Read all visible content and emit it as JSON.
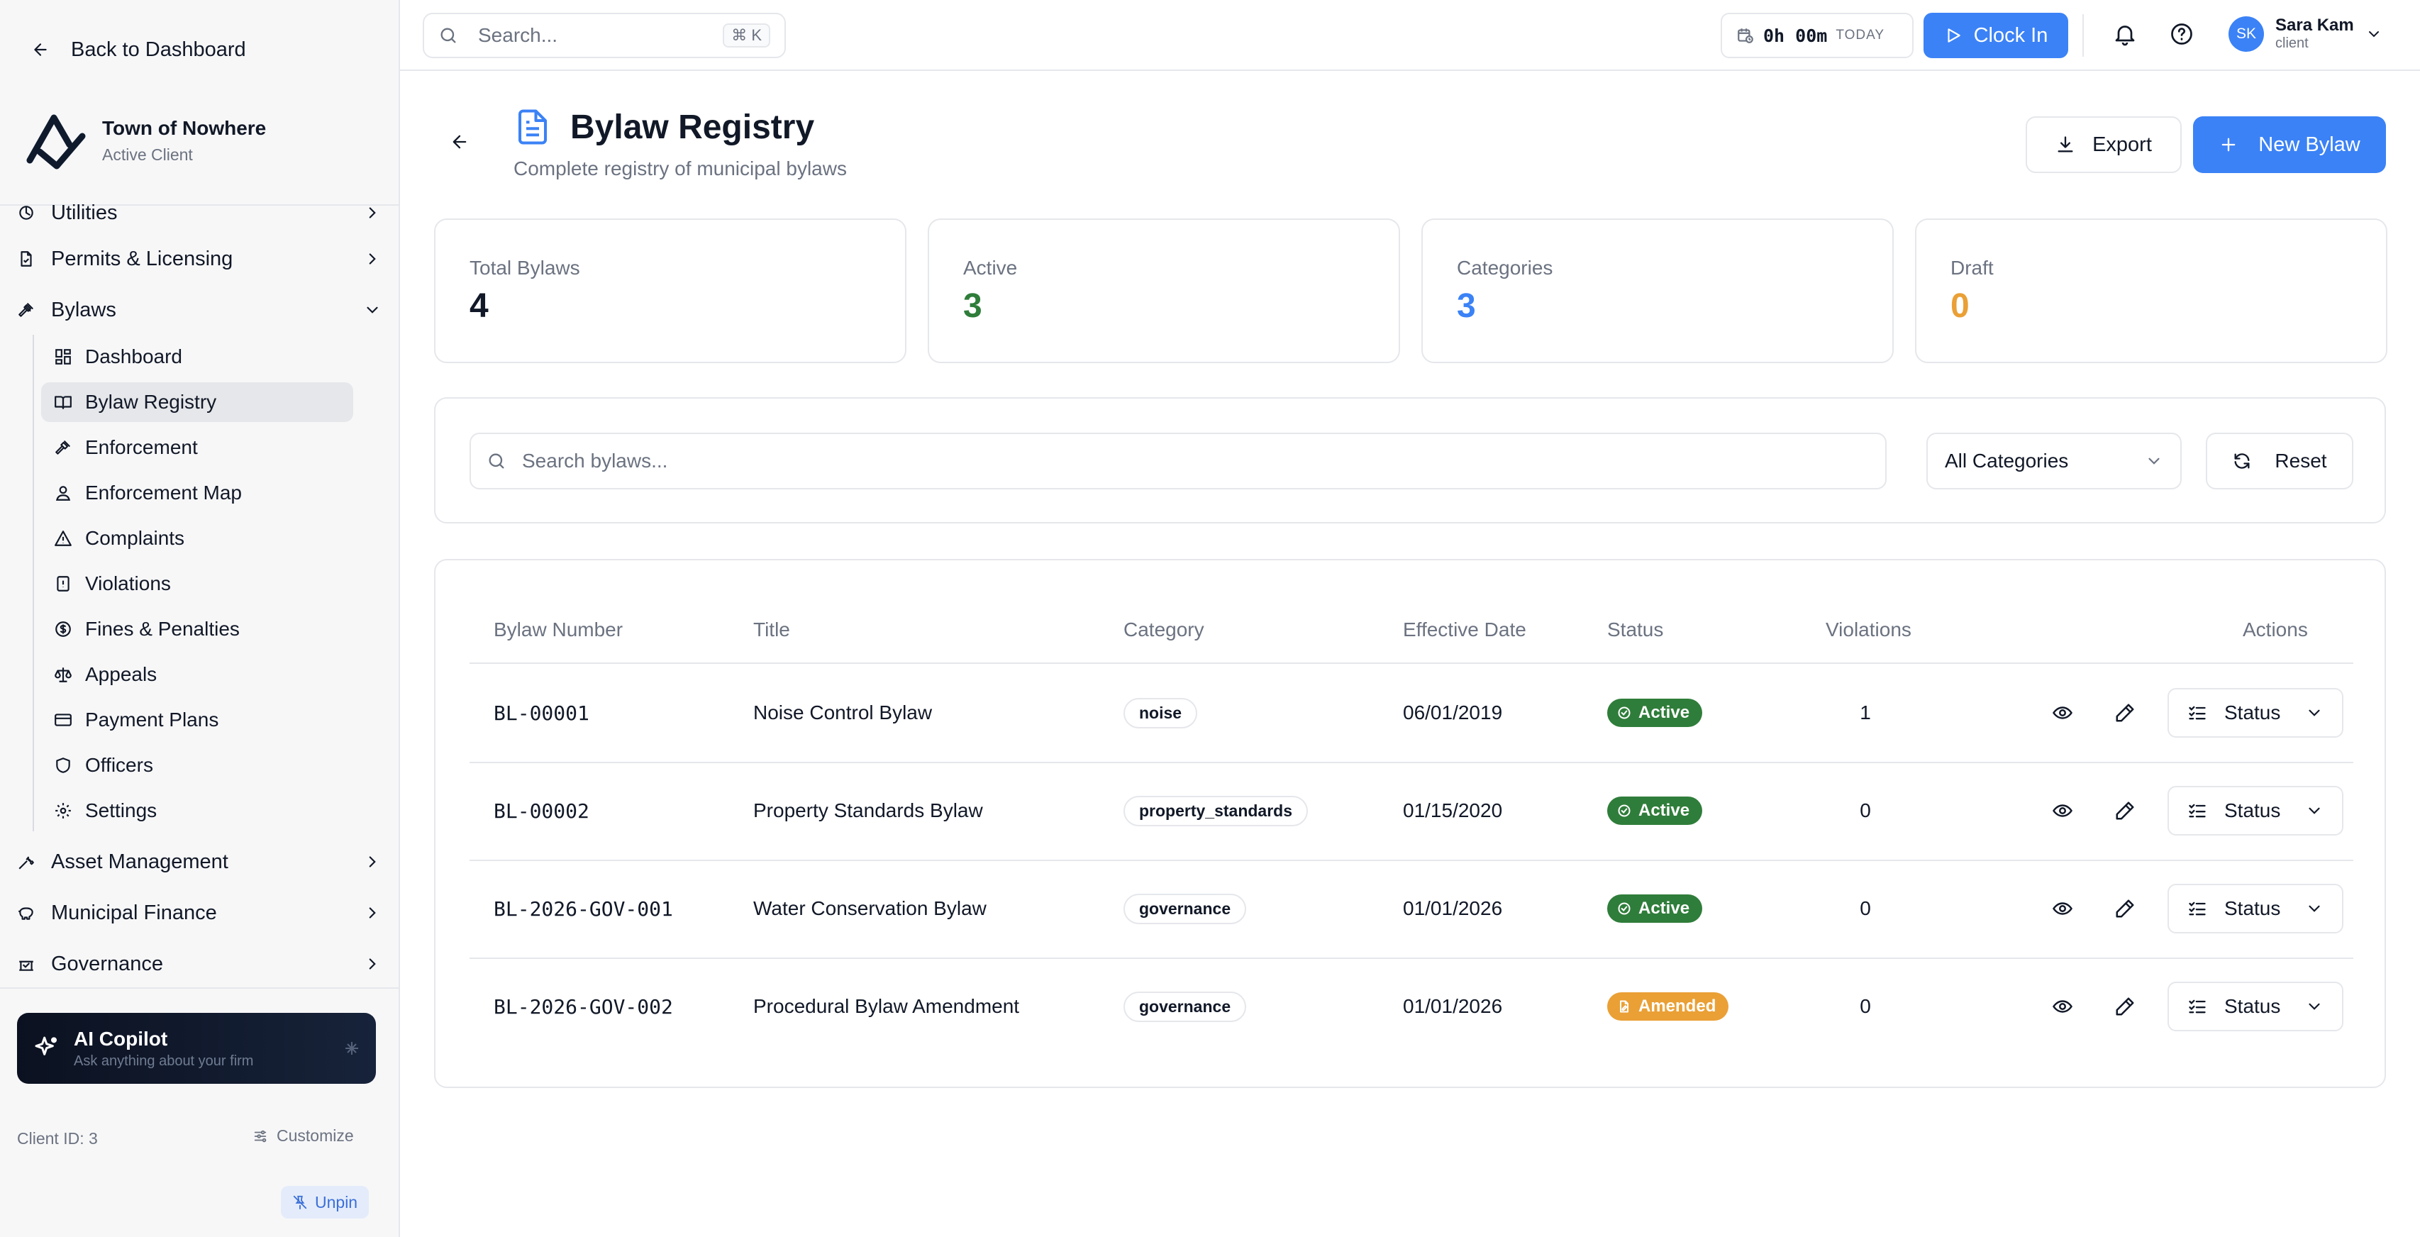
{
  "sidebar": {
    "back_label": "Back to Dashboard",
    "brand_name": "Town of Nowhere",
    "brand_sub": "Active Client",
    "nav": {
      "utilities": "Utilities",
      "permits": "Permits & Licensing",
      "bylaws": "Bylaws",
      "asset": "Asset Management",
      "finance": "Municipal Finance",
      "governance": "Governance"
    },
    "sub": {
      "dashboard": "Dashboard",
      "registry": "Bylaw Registry",
      "enforcement": "Enforcement",
      "map": "Enforcement Map",
      "complaints": "Complaints",
      "violations": "Violations",
      "fines": "Fines & Penalties",
      "appeals": "Appeals",
      "payment": "Payment Plans",
      "officers": "Officers",
      "settings": "Settings"
    },
    "copilot": {
      "title": "AI Copilot",
      "subtitle": "Ask anything about your firm"
    },
    "client_id": "Client ID: 3",
    "customize": "Customize",
    "unpin": "Unpin"
  },
  "topbar": {
    "search_placeholder": "Search...",
    "shortcut": "⌘ K",
    "timer": "0h 00m",
    "timer_label": "TODAY",
    "clock_in": "Clock In",
    "user_initials": "SK",
    "user_name": "Sara Kam",
    "user_role": "client"
  },
  "page": {
    "title": "Bylaw Registry",
    "subtitle": "Complete registry of municipal bylaws",
    "export_label": "Export",
    "new_label": "New Bylaw"
  },
  "stats": [
    {
      "label": "Total Bylaws",
      "value": "4",
      "color": "#111827"
    },
    {
      "label": "Active",
      "value": "3",
      "color": "#2f7d3a"
    },
    {
      "label": "Categories",
      "value": "3",
      "color": "#3b82f6"
    },
    {
      "label": "Draft",
      "value": "0",
      "color": "#eaa035"
    }
  ],
  "filters": {
    "search_placeholder": "Search bylaws...",
    "category": "All Categories",
    "reset": "Reset"
  },
  "table": {
    "headers": {
      "number": "Bylaw Number",
      "title": "Title",
      "category": "Category",
      "date": "Effective Date",
      "status": "Status",
      "violations": "Violations",
      "actions": "Actions"
    },
    "status_action": "Status",
    "rows": [
      {
        "number": "BL-00001",
        "title": "Noise Control Bylaw",
        "category": "noise",
        "date": "06/01/2019",
        "status": "Active",
        "violations": "1"
      },
      {
        "number": "BL-00002",
        "title": "Property Standards Bylaw",
        "category": "property_standards",
        "date": "01/15/2020",
        "status": "Active",
        "violations": "0"
      },
      {
        "number": "BL-2026-GOV-001",
        "title": "Water Conservation Bylaw",
        "category": "governance",
        "date": "01/01/2026",
        "status": "Active",
        "violations": "0"
      },
      {
        "number": "BL-2026-GOV-002",
        "title": "Procedural Bylaw Amendment",
        "category": "governance",
        "date": "01/01/2026",
        "status": "Amended",
        "violations": "0"
      }
    ]
  },
  "colors": {
    "primary": "#3b82f6",
    "active": "#2f7d3a",
    "amended": "#eaa035"
  }
}
